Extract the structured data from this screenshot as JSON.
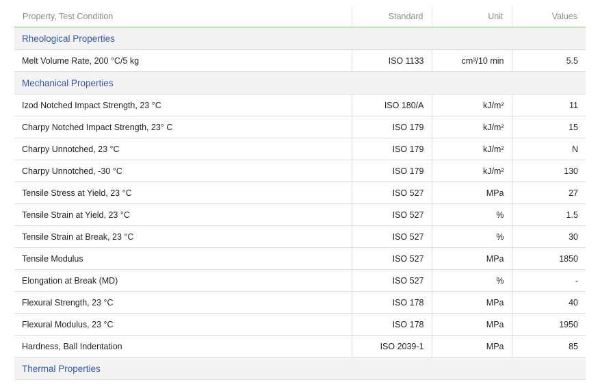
{
  "table": {
    "headers": {
      "property": "Property, Test Condition",
      "standard": "Standard",
      "unit": "Unit",
      "values": "Values"
    },
    "sections": [
      {
        "title": "Rheological Properties",
        "rows": [
          {
            "property": "Melt Volume Rate, 200 °C/5 kg",
            "standard": "ISO 1133",
            "unit": "cm³/10 min",
            "value": "5.5"
          }
        ]
      },
      {
        "title": "Mechanical Properties",
        "rows": [
          {
            "property": "Izod Notched Impact Strength, 23 °C",
            "standard": "ISO 180/A",
            "unit": "kJ/m²",
            "value": "11"
          },
          {
            "property": "Charpy Notched Impact Strength, 23° C",
            "standard": "ISO 179",
            "unit": "kJ/m²",
            "value": "15"
          },
          {
            "property": "Charpy Unnotched, 23 °C",
            "standard": "ISO 179",
            "unit": "kJ/m²",
            "value": "N"
          },
          {
            "property": "Charpy Unnotched, -30 °C",
            "standard": "ISO 179",
            "unit": "kJ/m²",
            "value": "130"
          },
          {
            "property": "Tensile Stress at Yield, 23 °C",
            "standard": "ISO 527",
            "unit": "MPa",
            "value": "27"
          },
          {
            "property": "Tensile Strain at Yield, 23 °C",
            "standard": "ISO 527",
            "unit": "%",
            "value": "1.5"
          },
          {
            "property": "Tensile Strain at Break, 23 °C",
            "standard": "ISO 527",
            "unit": "%",
            "value": "30"
          },
          {
            "property": "Tensile Modulus",
            "standard": "ISO 527",
            "unit": "MPa",
            "value": "1850"
          },
          {
            "property": "Elongation at Break (MD)",
            "standard": "ISO 527",
            "unit": "%",
            "value": "-"
          },
          {
            "property": "Flexural Strength, 23 °C",
            "standard": "ISO 178",
            "unit": "MPa",
            "value": "40"
          },
          {
            "property": "Flexural Modulus, 23 °C",
            "standard": "ISO 178",
            "unit": "MPa",
            "value": "1950"
          },
          {
            "property": "Hardness, Ball Indentation",
            "standard": "ISO 2039-1",
            "unit": "MPa",
            "value": "85"
          }
        ]
      },
      {
        "title": "Thermal Properties",
        "rows": []
      }
    ]
  }
}
